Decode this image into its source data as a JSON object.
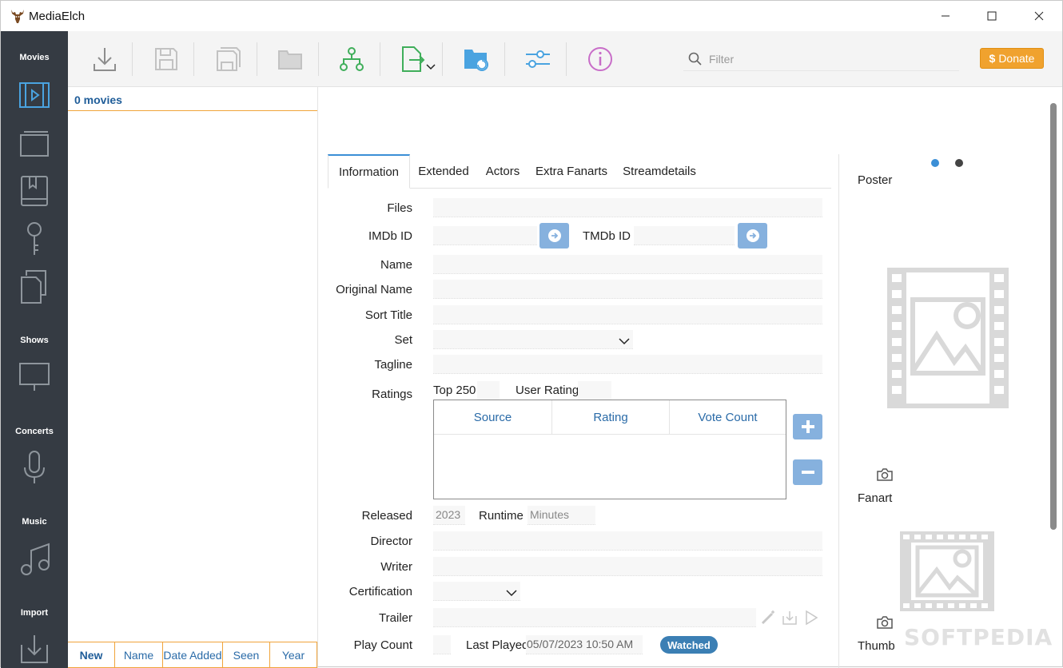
{
  "window": {
    "title": "MediaElch"
  },
  "sidebar": {
    "sections": [
      {
        "heading": "Movies"
      },
      {
        "heading": "Shows"
      },
      {
        "heading": "Concerts"
      },
      {
        "heading": "Music"
      },
      {
        "heading": "Import"
      }
    ]
  },
  "toolbar": {
    "filter_placeholder": "Filter",
    "donate_label": "Donate",
    "donate_symbol": "$"
  },
  "movie_list": {
    "count_label": "0 movies",
    "sort_buttons": [
      "New",
      "Name",
      "Date Added",
      "Seen",
      "Year"
    ],
    "active_sort": "New"
  },
  "tabs": [
    "Information",
    "Extended",
    "Actors",
    "Extra Fanarts",
    "Streamdetails"
  ],
  "active_tab": "Information",
  "form": {
    "files_label": "Files",
    "imdb_label": "IMDb ID",
    "tmdb_label": "TMDb ID",
    "name_label": "Name",
    "original_name_label": "Original Name",
    "sort_title_label": "Sort Title",
    "set_label": "Set",
    "tagline_label": "Tagline",
    "ratings_label": "Ratings",
    "top250_label": "Top 250",
    "user_rating_label": "User Rating",
    "ratings_columns": [
      "Source",
      "Rating",
      "Vote Count"
    ],
    "released_label": "Released",
    "released_value": "2023",
    "runtime_label": "Runtime",
    "runtime_placeholder": "Minutes",
    "director_label": "Director",
    "writer_label": "Writer",
    "certification_label": "Certification",
    "trailer_label": "Trailer",
    "play_count_label": "Play Count",
    "last_played_label": "Last Played",
    "last_played_value": "05/07/2023 10:50 AM",
    "watched_label": "Watched"
  },
  "images": {
    "poster_label": "Poster",
    "fanart_label": "Fanart",
    "thumb_label": "Thumb"
  },
  "watermark": "SOFTPEDIA",
  "colors": {
    "sidebar_bg": "#353b43",
    "accent_blue": "#3b8fd6",
    "accent_orange": "#f0a43a",
    "donate_bg": "#f0a22e",
    "button_blue": "#86b1de"
  }
}
